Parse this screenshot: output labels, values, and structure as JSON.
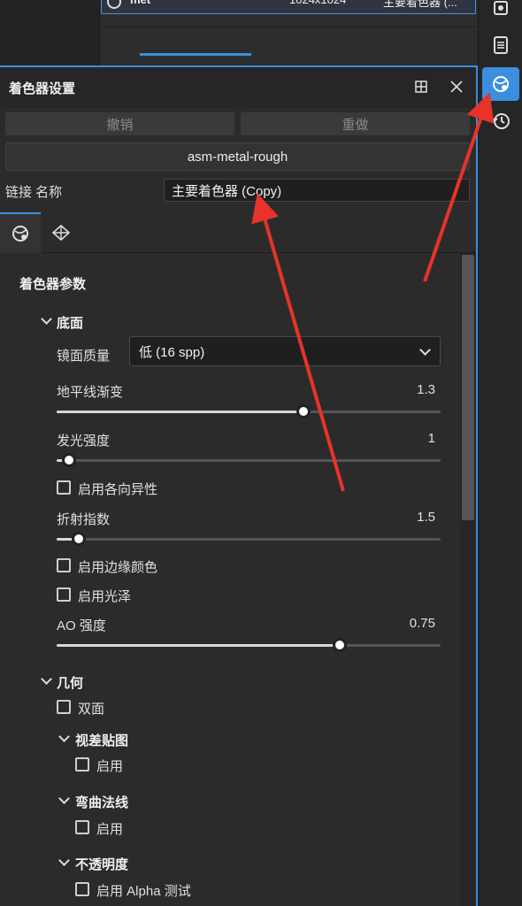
{
  "top_row": {
    "name": "met",
    "size": "1024x1024",
    "shader": "主要着色器 (..."
  },
  "panel": {
    "title": "着色器设置",
    "undo_label": "撤销",
    "redo_label": "重做",
    "shader_name": "asm-metal-rough",
    "link_label": "链接 名称",
    "link_value": "主要着色器 (Copy)"
  },
  "params": {
    "header": "着色器参数",
    "base": {
      "title": "底面",
      "specular_quality_label": "镜面质量",
      "specular_quality_value": "低 (16 spp)",
      "horizon_fade": {
        "label": "地平线渐变",
        "value": "1.3",
        "fraction": 0.643
      },
      "emissive_intensity": {
        "label": "发光强度",
        "value": "1",
        "fraction": 0.033
      },
      "anisotropy_label": "启用各向异性",
      "ior": {
        "label": "折射指数",
        "value": "1.5",
        "fraction": 0.058
      },
      "edge_color_label": "启用边缘颜色",
      "sheen_label": "启用光泽",
      "ao": {
        "label": "AO 强度",
        "value": "0.75",
        "fraction": 0.737
      }
    },
    "geometry": {
      "title": "几何",
      "double_sided_label": "双面",
      "parallax": {
        "title": "视差贴图",
        "enable_label": "启用"
      },
      "bent_normals": {
        "title": "弯曲法线",
        "enable_label": "启用"
      },
      "opacity": {
        "title": "不透明度",
        "alpha_test_label": "启用 Alpha 测试"
      }
    }
  },
  "icons": {
    "close": "close-icon",
    "dock": "dock-icon",
    "shader_tab": "shader-sphere-icon",
    "geometry_tab": "geometry-icon",
    "settings": "gear-icon",
    "log": "list-icon",
    "shader_settings": "shader-settings-icon",
    "history": "history-icon"
  },
  "colors": {
    "accent": "#3b8ee0",
    "annotation_arrow": "#e8322a"
  }
}
